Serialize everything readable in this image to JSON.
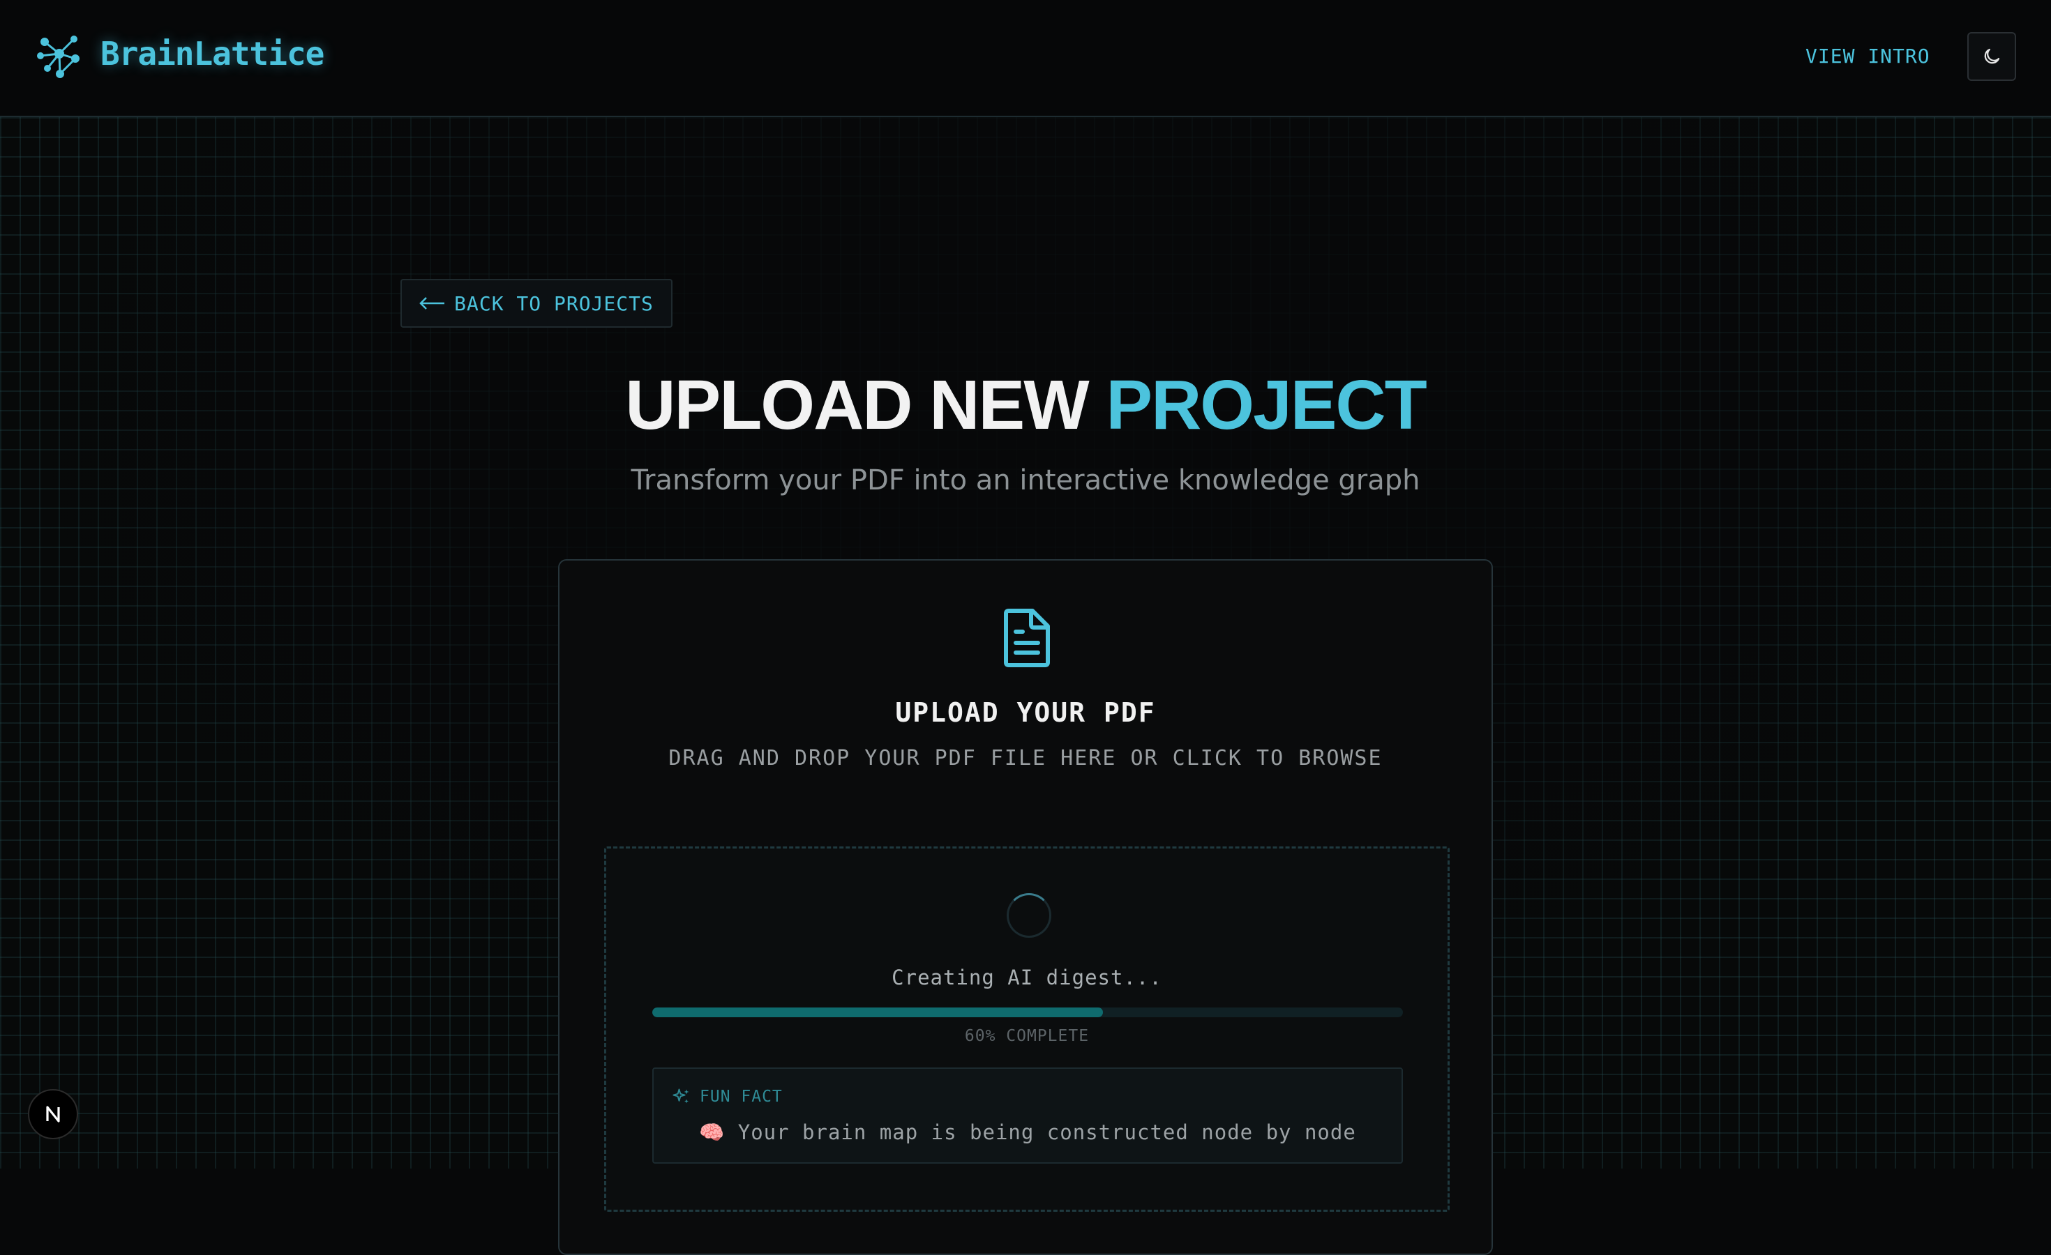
{
  "header": {
    "brand": "BrainLattice",
    "view_intro": "VIEW INTRO",
    "theme_icon": "moon-icon",
    "logo_icon": "lattice-logo-icon"
  },
  "back_button": {
    "label": "BACK TO PROJECTS",
    "icon": "arrow-left-icon"
  },
  "page": {
    "title_main": "UPLOAD NEW",
    "title_accent": "PROJECT",
    "subtitle": "Transform your PDF into an interactive knowledge graph"
  },
  "upload": {
    "icon": "file-text-icon",
    "title": "UPLOAD YOUR PDF",
    "subtitle": "DRAG AND DROP YOUR PDF FILE HERE OR CLICK TO BROWSE",
    "status": "Creating AI digest...",
    "progress_percent": 60,
    "progress_label": "60% COMPLETE",
    "fun_fact": {
      "icon": "sparkles-icon",
      "heading": "FUN FACT",
      "text": "🧠 Your brain map is being constructed node by node"
    }
  },
  "dev_badge": {
    "label": "N"
  },
  "colors": {
    "accent": "#4cc3dd",
    "progress": "#0f6b6e",
    "background": "#070809"
  }
}
